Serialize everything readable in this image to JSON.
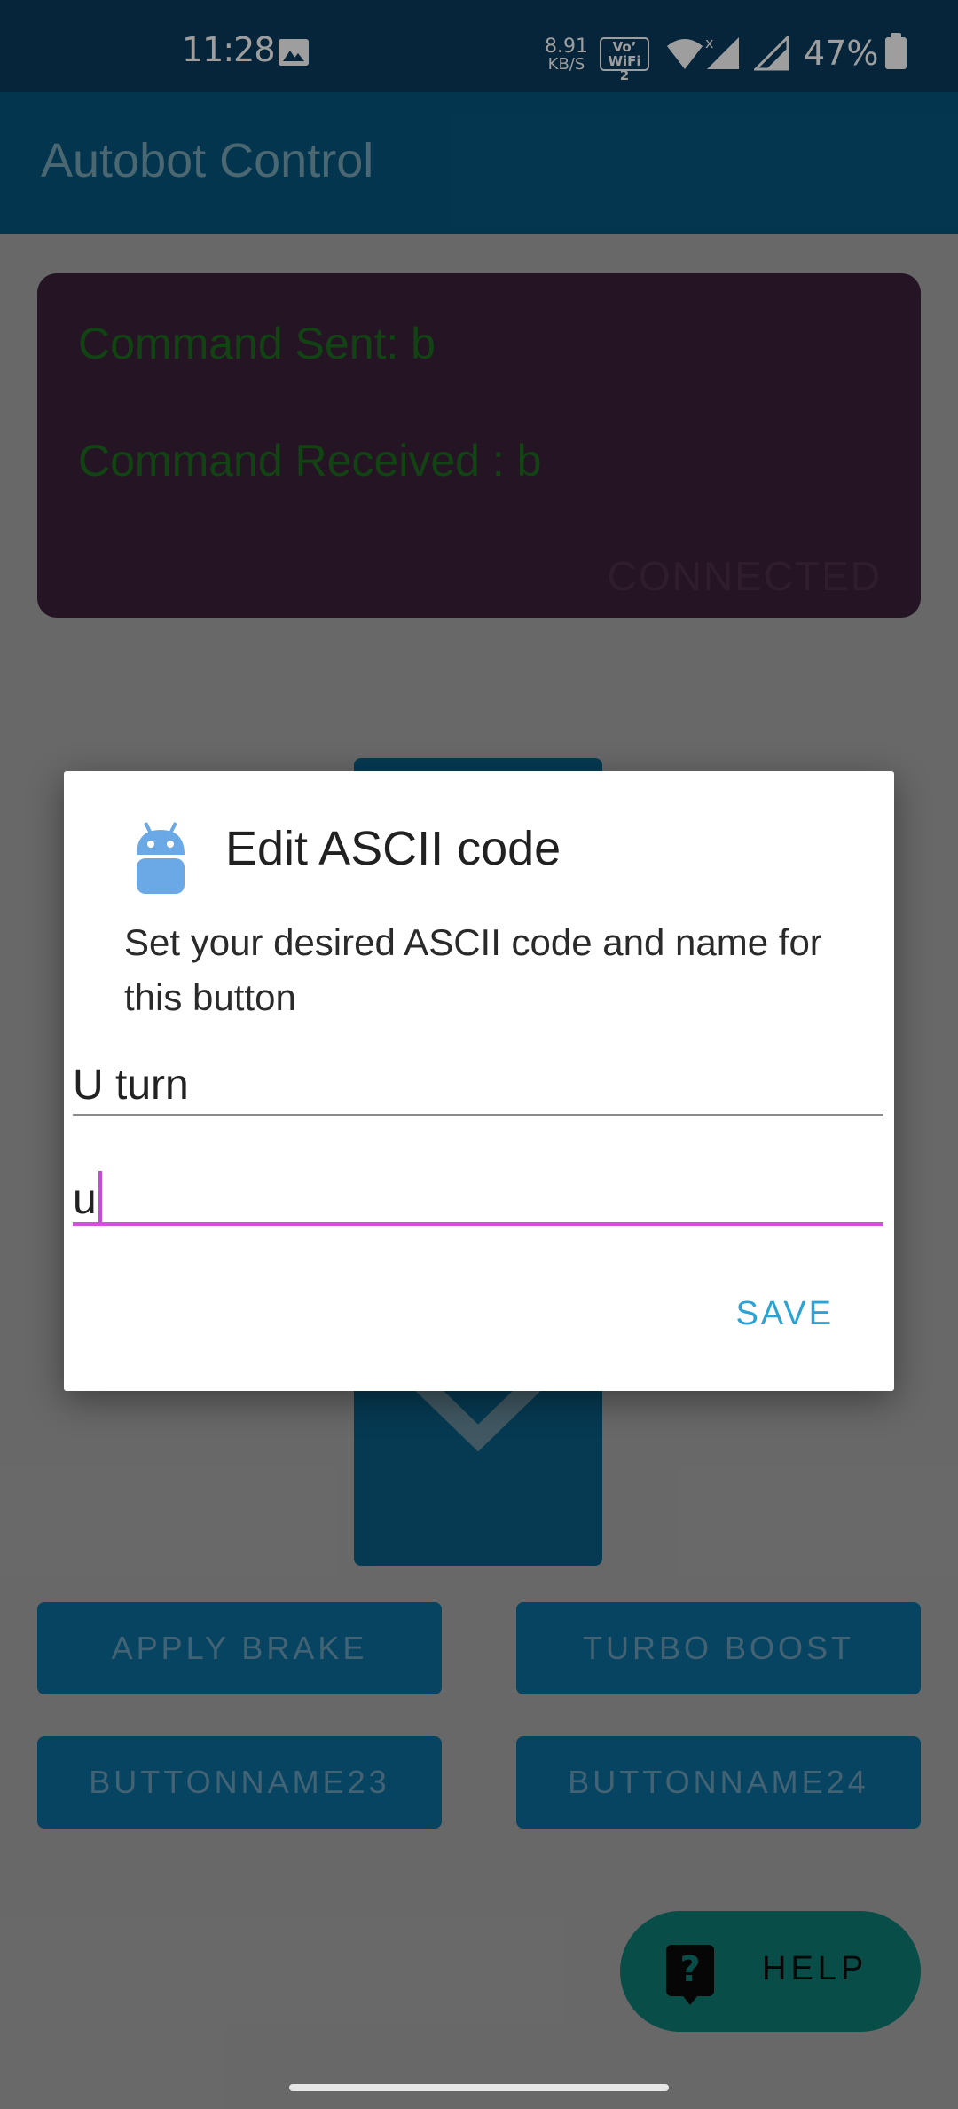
{
  "status_bar": {
    "time": "11:28",
    "speed_value": "8.91",
    "speed_unit": "KB/S",
    "volte_line1": "Vo’",
    "volte_line2": "WiFi 2",
    "battery": "47%",
    "icons": [
      "image-icon",
      "wifi-icon",
      "signal-icon",
      "signal-icon",
      "battery-icon"
    ]
  },
  "app_bar": {
    "title": "Autobot Control"
  },
  "console": {
    "sent": "Command Sent: b",
    "received": "Command Received : b",
    "status": "CONNECTED"
  },
  "buttons": [
    "APPLY BRAKE",
    "TURBO BOOST",
    "BUTTONNAME23",
    "BUTTONNAME24"
  ],
  "fab": {
    "label": "HELP",
    "icon": "help-icon"
  },
  "dialog": {
    "title": "Edit ASCII code",
    "message": "Set your desired ASCII code and name for this button",
    "name_value": "U turn",
    "code_value": "u",
    "save_label": "SAVE",
    "icon": "android-icon"
  },
  "colors": {
    "status_bar": "#0a3c5e",
    "app_bar": "#06587f",
    "console_bg": "#3b213a",
    "console_text": "#1d6e1f",
    "button_bg": "#0a6e9e",
    "fab_bg": "#0d7d74",
    "accent": "#d34fe0",
    "save_text": "#2aa3d6"
  }
}
